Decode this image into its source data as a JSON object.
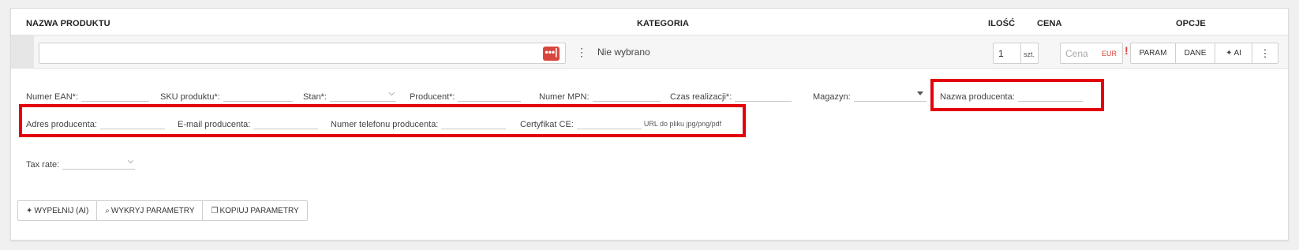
{
  "header": {
    "name": "NAZWA PRODUKTU",
    "category": "KATEGORIA",
    "qty": "ILOŚĆ",
    "price": "CENA",
    "options": "OPCJE"
  },
  "product_row": {
    "name_value": "",
    "more_button": "•••|",
    "category_kebab": "⋮",
    "category_value": "Nie wybrano",
    "qty_value": "1",
    "qty_unit": "szt.",
    "price_placeholder": "Cena",
    "currency": "EUR",
    "price_warning": "!",
    "options": {
      "param": "PARAM",
      "dane": "DANE",
      "ai_icon": "✦",
      "ai": "AI",
      "more": "⋮"
    }
  },
  "fields": {
    "ean": "Numer EAN*:",
    "sku": "SKU produktu*:",
    "stan": "Stan*:",
    "producent": "Producent*:",
    "mpn": "Numer MPN:",
    "czas": "Czas realizacji*:",
    "magazyn": "Magazyn:",
    "nazwa_producenta": "Nazwa producenta:",
    "adres_producenta": "Adres producenta:",
    "email_producenta": "E-mail producenta:",
    "telefon_producenta": "Numer telefonu producenta:",
    "certyfikat": "Certyfikat CE:",
    "certyfikat_hint": "URL do pliku jpg/png/pdf",
    "tax_rate": "Tax rate:"
  },
  "actions": {
    "fill_ai": "WYPEŁNIJ (AI)",
    "detect": "WYKRYJ PARAMETRY",
    "copy": "KOPIUJ PARAMETRY"
  },
  "colors": {
    "highlight": "#e3000b",
    "accent_red": "#d9463e"
  }
}
